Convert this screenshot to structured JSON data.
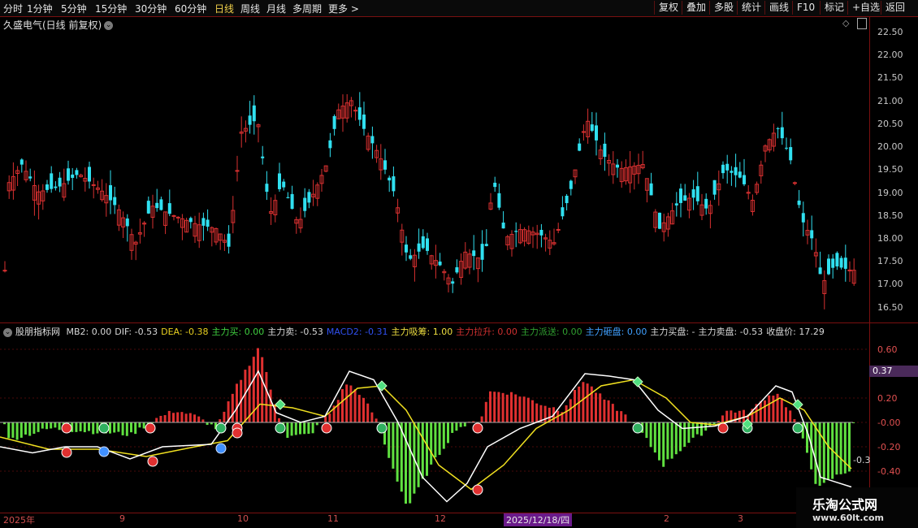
{
  "toolbar": {
    "periods": [
      "分时",
      "1分钟",
      "5分钟",
      "15分钟",
      "30分钟",
      "60分钟",
      "日线",
      "周线",
      "月线",
      "多周期",
      "更多 >"
    ],
    "active_period": "日线",
    "right_buttons": [
      "复权",
      "叠加",
      "多股",
      "统计",
      "画线",
      "F10",
      "标记",
      "+自选",
      "返回"
    ]
  },
  "stock": {
    "title": "久盛电气(日线 前复权)"
  },
  "price_axis": {
    "ticks": [
      "22.50",
      "22.00",
      "21.50",
      "21.00",
      "20.50",
      "20.00",
      "19.50",
      "19.00",
      "18.50",
      "18.00",
      "17.50",
      "17.00",
      "16.50"
    ]
  },
  "indicator": {
    "name": "股朋指标网",
    "fields": [
      {
        "text": "MB2: 0.00",
        "color": "#d8d8d8"
      },
      {
        "text": "DIF: -0.53",
        "color": "#d8d8d8"
      },
      {
        "text": "DEA: -0.38",
        "color": "#e8d020"
      },
      {
        "text": "主力买: 0.00",
        "color": "#40d040"
      },
      {
        "text": "主力卖: -0.53",
        "color": "#d8d8d8"
      },
      {
        "text": "MACD2: -0.31",
        "color": "#3050f0"
      },
      {
        "text": "主力吸筹: 1.00",
        "color": "#f0e040"
      },
      {
        "text": "主力拉升: 0.00",
        "color": "#d03030"
      },
      {
        "text": "主力派送: 0.00",
        "color": "#30a030"
      },
      {
        "text": "主力砸盘: 0.00",
        "color": "#40a0ff"
      },
      {
        "text": "主力买盘: -",
        "color": "#d8d8d8"
      },
      {
        "text": "主力卖盘: -0.53",
        "color": "#d8d8d8"
      },
      {
        "text": "收盘价: 17.29",
        "color": "#d8d8d8"
      }
    ],
    "axis_ticks": [
      "0.60",
      "0.40",
      "0.20",
      "-0.00",
      "-0.20",
      "-0.40"
    ],
    "current_value_badge": "0.37",
    "partial_label": "-0.3"
  },
  "date_axis": {
    "labels": [
      "2025年",
      "9",
      "10",
      "11",
      "12",
      "2025/12/18/四",
      "2",
      "3"
    ]
  },
  "watermark": {
    "name": "乐淘公式网",
    "url": "www.60lt.com"
  },
  "colors": {
    "up": "#d83030",
    "down": "#30e0f0",
    "grid": "#7a1010",
    "dif": "#ffffff",
    "dea": "#f0e020",
    "hist_up": "#e03030",
    "hist_down": "#60e040"
  }
}
